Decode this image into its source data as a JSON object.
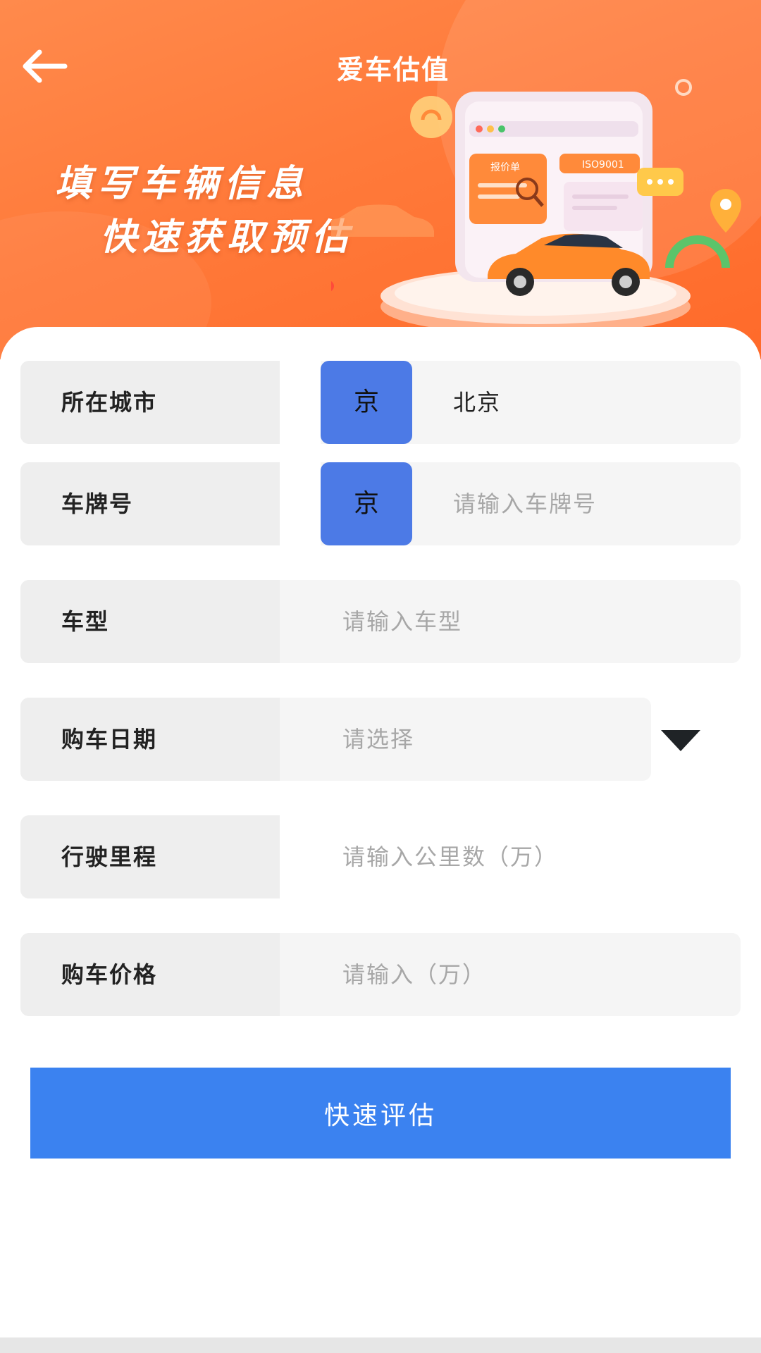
{
  "header": {
    "title": "爱车估值",
    "back_icon": "arrow-left-icon",
    "slogan_line1": "填写车辆信息",
    "slogan_line2": "快速获取预估",
    "illustration_badges": {
      "quote": "报价单",
      "iso": "ISO9001"
    }
  },
  "form": {
    "city": {
      "label": "所在城市",
      "prefix": "京",
      "value": "北京"
    },
    "plate": {
      "label": "车牌号",
      "prefix": "京",
      "placeholder": "请输入车牌号"
    },
    "model": {
      "label": "车型",
      "placeholder": "请输入车型"
    },
    "purchase_date": {
      "label": "购车日期",
      "placeholder": "请选择",
      "dropdown_icon": "triangle-down-icon"
    },
    "mileage": {
      "label": "行驶里程",
      "placeholder": "请输入公里数（万）"
    },
    "price": {
      "label": "购车价格",
      "placeholder": "请输入（万）"
    }
  },
  "submit": {
    "label": "快速评估"
  },
  "colors": {
    "banner_orange": "#ff7a3a",
    "plate_blue": "#4c7ae6",
    "button_blue": "#3b82f0",
    "label_bg": "#eeeeee",
    "field_bg": "#f5f5f5"
  }
}
